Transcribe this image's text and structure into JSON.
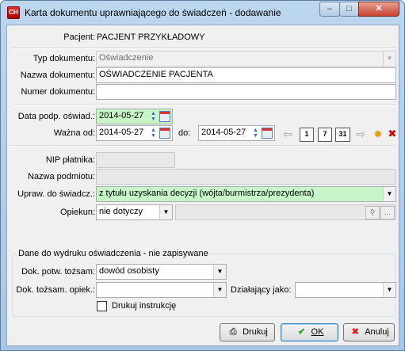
{
  "window": {
    "title": "Karta dokumentu uprawniającego do świadczeń - dodawanie",
    "minimize": "–",
    "maximize": "□",
    "close": "✕",
    "app_icon_glyph": "CH"
  },
  "patient": {
    "label": "Pacjent:",
    "value": "PACJENT PRZYKŁADOWY"
  },
  "document": {
    "type_label": "Typ dokumentu:",
    "type_value": "Oświadczenie",
    "name_label": "Nazwa dokumentu:",
    "name_value": "OŚWIADCZENIE PACJENTA",
    "number_label": "Numer dokumentu:",
    "number_value": ""
  },
  "dates": {
    "signed_label": "Data podp. oświad.:",
    "signed_value": "2014-05-27",
    "valid_from_label": "Ważna od:",
    "valid_from_value": "2014-05-27",
    "to_label": "do:",
    "valid_to_value": "2014-05-27",
    "nav_buttons": [
      "1",
      "7",
      "31"
    ]
  },
  "payer": {
    "nip_label": "NIP płatnika:",
    "nip_value": "",
    "entity_label": "Nazwa podmiotu:",
    "entity_value": "",
    "entitlement_label": "Upraw. do świadcz.:",
    "entitlement_value": "z tytułu uzyskania decyzji (wójta/burmistrza/prezydenta)",
    "guardian_label": "Opiekun:",
    "guardian_value": "nie dotyczy",
    "guardian_detail_value": "",
    "guardian_more": "..."
  },
  "print_group": {
    "title": "Dane do wydruku oświadczenia - nie zapisywane",
    "id_doc_label": "Dok. potw. tożsam:",
    "id_doc_value": "dowód osobisty",
    "guardian_id_label": "Dok. tożsam. opiek.:",
    "guardian_id_value": "",
    "acting_as_label": "Działający jako:",
    "acting_as_value": "",
    "print_instructions_label": "Drukuj instrukcję",
    "print_instructions_checked": false
  },
  "buttons": {
    "print_label": "Drukuj",
    "ok_label": "OK",
    "cancel_label": "Anuluj"
  },
  "colors": {
    "required_field": "#c8f5c8",
    "window_frame": "#a9c6e4"
  }
}
